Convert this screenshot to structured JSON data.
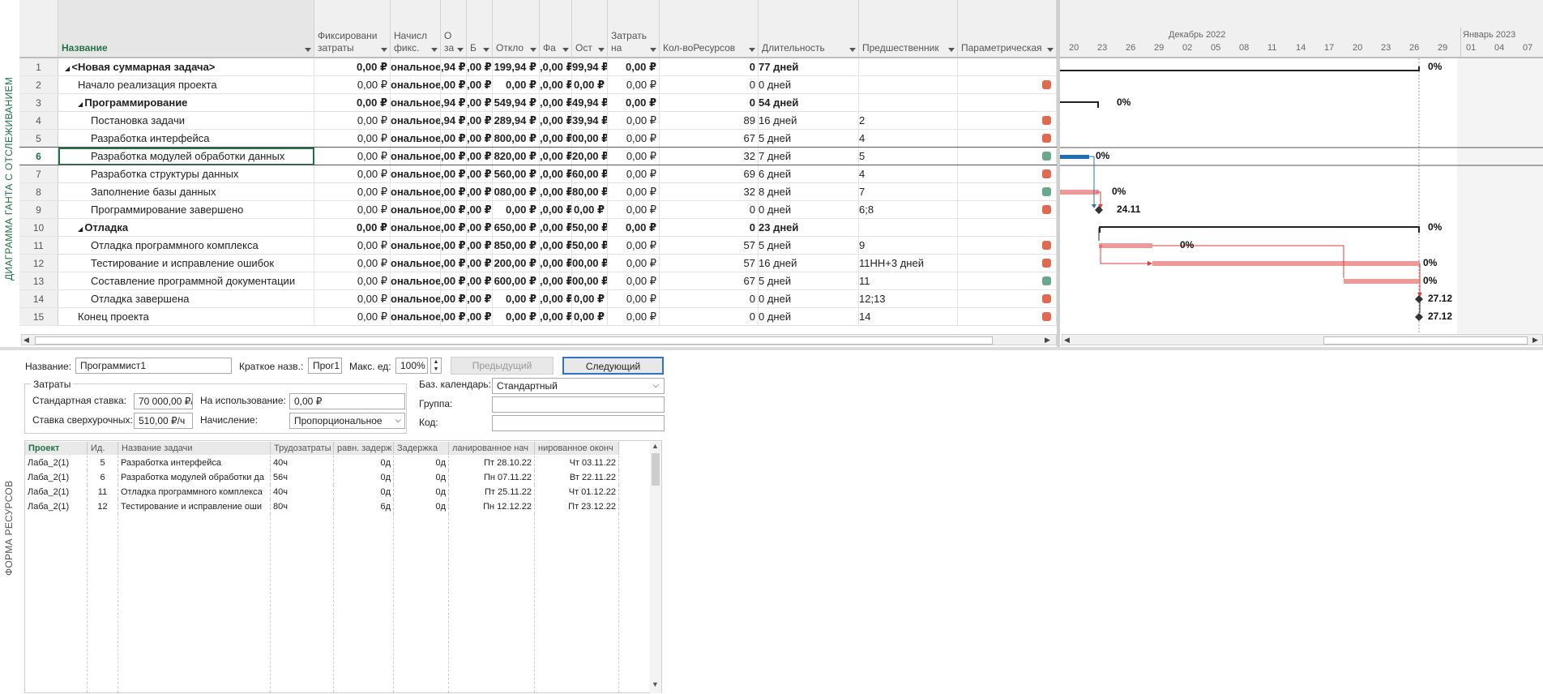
{
  "side_labels": {
    "gantt": "ДИАГРАММА ГАНТА С ОТСЛЕЖИВАНИЕМ",
    "form": "ФОРМА РЕСУРСОВ"
  },
  "colors": {
    "accent_green": "#217346",
    "indicator_red": "#e06a4f",
    "indicator_green": "#6aa88e",
    "bar_red": "#ef9a9a",
    "bar_blue": "#1f6fb8",
    "link_red": "#e03c3c"
  },
  "columns": {
    "name": "Название",
    "fixed_cost": "Фиксировани затраты",
    "accrual": "Начисл фикс.",
    "o": "О за",
    "b": "Б",
    "deviation": "Откло",
    "fact": "Фа",
    "remaining": "Ост",
    "cost": "Затрать на",
    "res_count": "Кол-воРесурсов",
    "duration": "Длительность",
    "predecessors": "Предшественник",
    "param": "Параметрическая"
  },
  "tasks": [
    {
      "id": "1",
      "name": "<Новая суммарная задача>",
      "fixed": "0,00 ₽",
      "accr": "ональное",
      "o": ",94 ₽",
      "b": ",00 ₽",
      "dev": "199,94 ₽",
      "fact": ",0,00 ₽",
      "rem": "99,94 ₽",
      "cost": "0,00 ₽",
      "rc": "0",
      "dur": "77 дней",
      "pred": "",
      "ind": ""
    },
    {
      "id": "2",
      "name": "Начало реализация проекта",
      "fixed": "0,00 ₽",
      "accr": "ональное",
      "o": ",00 ₽",
      "b": ",00 ₽",
      "dev": "0,00 ₽",
      "fact": ",0,00 ₽",
      "rem": "0,00 ₽",
      "cost": "0,00 ₽",
      "rc": "0",
      "dur": "0 дней",
      "pred": "",
      "ind": "red"
    },
    {
      "id": "3",
      "name": "Программирование",
      "fixed": "0,00 ₽",
      "accr": "ональное",
      "o": ",94 ₽",
      "b": ",00 ₽",
      "dev": "549,94 ₽",
      "fact": ",0,00 ₽",
      "rem": "49,94 ₽",
      "cost": "0,00 ₽",
      "rc": "0",
      "dur": "54 дней",
      "pred": "",
      "ind": ""
    },
    {
      "id": "4",
      "name": "Постановка задачи",
      "fixed": "0,00 ₽",
      "accr": "ональное",
      "o": ",94 ₽",
      "b": ",00 ₽",
      "dev": "289,94 ₽",
      "fact": ",0,00 ₽",
      "rem": "39,94 ₽",
      "cost": "0,00 ₽",
      "rc": "89",
      "dur": "16 дней",
      "pred": "2",
      "ind": "red"
    },
    {
      "id": "5",
      "name": "Разработка интерфейса",
      "fixed": "0,00 ₽",
      "accr": "ональное",
      "o": ",00 ₽",
      "b": ",00 ₽",
      "dev": "800,00 ₽",
      "fact": ",0,00 ₽",
      "rem": "00,00 ₽",
      "cost": "0,00 ₽",
      "rc": "67",
      "dur": "5 дней",
      "pred": "4",
      "ind": "red"
    },
    {
      "id": "6",
      "name": "Разработка модулей обработки данных",
      "fixed": "0,00 ₽",
      "accr": "ональное",
      "o": ",00 ₽",
      "b": ",00 ₽",
      "dev": "820,00 ₽",
      "fact": ",0,00 ₽",
      "rem": "20,00 ₽",
      "cost": "0,00 ₽",
      "rc": "32",
      "dur": "7 дней",
      "pred": "5",
      "ind": "green"
    },
    {
      "id": "7",
      "name": "Разработка структуры данных",
      "fixed": "0,00 ₽",
      "accr": "ональное",
      "o": ",00 ₽",
      "b": ",00 ₽",
      "dev": "560,00 ₽",
      "fact": ",0,00 ₽",
      "rem": "60,00 ₽",
      "cost": "0,00 ₽",
      "rc": "69",
      "dur": "6 дней",
      "pred": "4",
      "ind": "red"
    },
    {
      "id": "8",
      "name": "Заполнение базы данных",
      "fixed": "0,00 ₽",
      "accr": "ональное",
      "o": ",00 ₽",
      "b": ",00 ₽",
      "dev": "080,00 ₽",
      "fact": ",0,00 ₽",
      "rem": "80,00 ₽",
      "cost": "0,00 ₽",
      "rc": "32",
      "dur": "8 дней",
      "pred": "7",
      "ind": "green"
    },
    {
      "id": "9",
      "name": "Программирование завершено",
      "fixed": "0,00 ₽",
      "accr": "ональное",
      "o": ",00 ₽",
      "b": ",00 ₽",
      "dev": "0,00 ₽",
      "fact": ",0,00 ₽",
      "rem": "0,00 ₽",
      "cost": "0,00 ₽",
      "rc": "0",
      "dur": "0 дней",
      "pred": "6;8",
      "ind": "red"
    },
    {
      "id": "10",
      "name": "Отладка",
      "fixed": "0,00 ₽",
      "accr": "ональное",
      "o": ",00 ₽",
      "b": ",00 ₽",
      "dev": "650,00 ₽",
      "fact": ",0,00 ₽",
      "rem": "50,00 ₽",
      "cost": "0,00 ₽",
      "rc": "0",
      "dur": "23 дней",
      "pred": "",
      "ind": ""
    },
    {
      "id": "11",
      "name": "Отладка программного комплекса",
      "fixed": "0,00 ₽",
      "accr": "ональное",
      "o": ",00 ₽",
      "b": ",00 ₽",
      "dev": "850,00 ₽",
      "fact": ",0,00 ₽",
      "rem": "50,00 ₽",
      "cost": "0,00 ₽",
      "rc": "57",
      "dur": "5 дней",
      "pred": "9",
      "ind": "red"
    },
    {
      "id": "12",
      "name": "Тестирование и исправление ошибок",
      "fixed": "0,00 ₽",
      "accr": "ональное",
      "o": ",00 ₽",
      "b": ",00 ₽",
      "dev": "200,00 ₽",
      "fact": ",0,00 ₽",
      "rem": "00,00 ₽",
      "cost": "0,00 ₽",
      "rc": "57",
      "dur": "16 дней",
      "pred": "11НН+3 дней",
      "ind": "red"
    },
    {
      "id": "13",
      "name": "Составление программной документации",
      "fixed": "0,00 ₽",
      "accr": "ональное",
      "o": ",00 ₽",
      "b": ",00 ₽",
      "dev": "600,00 ₽",
      "fact": ",0,00 ₽",
      "rem": "00,00 ₽",
      "cost": "0,00 ₽",
      "rc": "67",
      "dur": "5 дней",
      "pred": "11",
      "ind": "green"
    },
    {
      "id": "14",
      "name": "Отладка завершена",
      "fixed": "0,00 ₽",
      "accr": "ональное",
      "o": ",00 ₽",
      "b": ",00 ₽",
      "dev": "0,00 ₽",
      "fact": ",0,00 ₽",
      "rem": "0,00 ₽",
      "cost": "0,00 ₽",
      "rc": "0",
      "dur": "0 дней",
      "pred": "12;13",
      "ind": "red"
    },
    {
      "id": "15",
      "name": "Конец проекта",
      "fixed": "0,00 ₽",
      "accr": "ональное",
      "o": ",00 ₽",
      "b": ",00 ₽",
      "dev": "0,00 ₽",
      "fact": ",0,00 ₽",
      "rem": "0,00 ₽",
      "cost": "0,00 ₽",
      "rc": "0",
      "dur": "0 дней",
      "pred": "14",
      "ind": "red"
    }
  ],
  "timeline": {
    "month1": "Декабрь 2022",
    "month2": "Январь 2023",
    "days": [
      "20",
      "23",
      "26",
      "29",
      "02",
      "05",
      "08",
      "11",
      "14",
      "17",
      "20",
      "23",
      "26",
      "29",
      "01",
      "04",
      "07"
    ],
    "labels": {
      "r1": "0%",
      "r3": "0%",
      "r6": "0%",
      "r8": "0%",
      "r9": "24.11",
      "r10": "0%",
      "r11": "0%",
      "r12": "0%",
      "r13": "0%",
      "r14": "27.12",
      "r15": "27.12"
    }
  },
  "form": {
    "name_label": "Название:",
    "name_value": "Программист1",
    "short_label": "Краткое назв.:",
    "short_value": "Прог1",
    "max_label": "Макс. ед:",
    "max_value": "100%",
    "prev_button": "Предыдущий",
    "next_button": "Следующий",
    "costs_group": "Затраты",
    "std_rate_label": "Стандартная ставка:",
    "std_rate_value": "70 000,00 ₽/ч",
    "overtime_label": "Ставка сверхурочных:",
    "overtime_value": "510,00 ₽/ч",
    "per_use_label": "На использование:",
    "per_use_value": "0,00 ₽",
    "accrual_label": "Начисление:",
    "accrual_value": "Пропорциональное",
    "base_cal_label": "Баз. календарь:",
    "base_cal_value": "Стандартный",
    "group_label": "Группа:",
    "group_value": "",
    "code_label": "Код:",
    "code_value": ""
  },
  "res_table": {
    "headers": [
      "Проект",
      "Ид.",
      "Название задачи",
      "Трудозатраты",
      "равн. задерж",
      "Задержка",
      "ланированное нач",
      "нированное оконч"
    ],
    "rows": [
      [
        "Лаба_2(1)",
        "5",
        "Разработка интерфейса",
        "40ч",
        "0д",
        "0д",
        "Пт 28.10.22",
        "Чт 03.11.22"
      ],
      [
        "Лаба_2(1)",
        "6",
        "Разработка модулей обработки да",
        "56ч",
        "0д",
        "0д",
        "Пн 07.11.22",
        "Вт 22.11.22"
      ],
      [
        "Лаба_2(1)",
        "11",
        "Отладка программного комплекса",
        "40ч",
        "0д",
        "0д",
        "Пт 25.11.22",
        "Чт 01.12.22"
      ],
      [
        "Лаба_2(1)",
        "12",
        "Тестирование и исправление оши",
        "80ч",
        "6д",
        "0д",
        "Пн 12.12.22",
        "Пт 23.12.22"
      ]
    ]
  }
}
